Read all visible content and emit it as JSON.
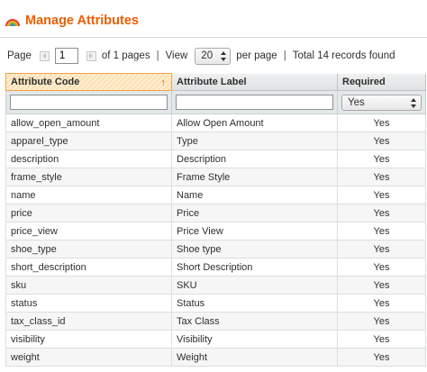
{
  "header": {
    "title": "Manage Attributes",
    "icon": "rainbow-icon",
    "title_color": "#eb5e00"
  },
  "pager": {
    "page_label": "Page",
    "page_value": "1",
    "of_pages": "of 1 pages",
    "view_label": "View",
    "limit_value": "20",
    "per_page": "per page",
    "total": "Total 14 records found",
    "separator": "|"
  },
  "grid": {
    "columns": [
      {
        "label": "Attribute Code",
        "sorted": true,
        "sort_direction": "↑"
      },
      {
        "label": "Attribute Label",
        "sorted": false
      },
      {
        "label": "Required",
        "sorted": false
      }
    ],
    "filters": {
      "code": "",
      "label": "",
      "required": "Yes"
    },
    "rows": [
      {
        "code": "allow_open_amount",
        "label": "Allow Open Amount",
        "required": "Yes"
      },
      {
        "code": "apparel_type",
        "label": "Type",
        "required": "Yes"
      },
      {
        "code": "description",
        "label": "Description",
        "required": "Yes"
      },
      {
        "code": "frame_style",
        "label": "Frame Style",
        "required": "Yes"
      },
      {
        "code": "name",
        "label": "Name",
        "required": "Yes"
      },
      {
        "code": "price",
        "label": "Price",
        "required": "Yes"
      },
      {
        "code": "price_view",
        "label": "Price View",
        "required": "Yes"
      },
      {
        "code": "shoe_type",
        "label": "Shoe type",
        "required": "Yes"
      },
      {
        "code": "short_description",
        "label": "Short Description",
        "required": "Yes"
      },
      {
        "code": "sku",
        "label": "SKU",
        "required": "Yes"
      },
      {
        "code": "status",
        "label": "Status",
        "required": "Yes"
      },
      {
        "code": "tax_class_id",
        "label": "Tax Class",
        "required": "Yes"
      },
      {
        "code": "visibility",
        "label": "Visibility",
        "required": "Yes"
      },
      {
        "code": "weight",
        "label": "Weight",
        "required": "Yes"
      }
    ]
  }
}
